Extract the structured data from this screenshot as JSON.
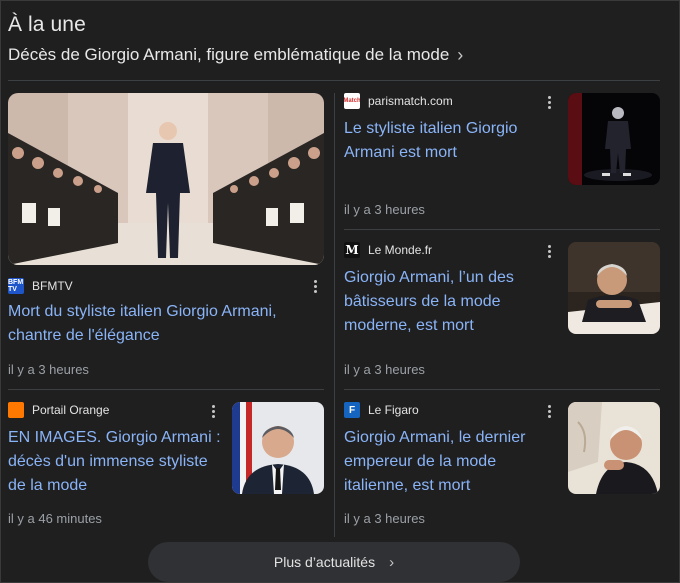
{
  "section_title": "À la une",
  "topic": {
    "title": "Décès de Giorgio Armani, figure emblématique de la mode",
    "chevron": "›"
  },
  "articles": [
    {
      "source": "BFMTV",
      "favicon_text": "BFM TV",
      "favicon_color": "#1e56c9",
      "headline": "Mort du styliste italien Giorgio Armani, chantre de l'élégance",
      "time": "il y a 3 heures"
    },
    {
      "source": "parismatch.com",
      "favicon_text": "Match",
      "favicon_color": "#d32f2f",
      "headline": "Le styliste italien Giorgio Armani est mort",
      "time": "il y a 3 heures"
    },
    {
      "source": "Le Monde.fr",
      "favicon_text": "M",
      "favicon_color": "#111111",
      "headline": "Giorgio Armani, l’un des bâtisseurs de la mode moderne, est mort",
      "time": "il y a 3 heures"
    },
    {
      "source": "Portail Orange",
      "favicon_text": "",
      "favicon_color": "#ff7900",
      "headline": "EN IMAGES. Giorgio Armani : décès d'un immense styliste de la mode",
      "time": "il y a 46 minutes"
    },
    {
      "source": "Le Figaro",
      "favicon_text": "F",
      "favicon_color": "#1565c0",
      "headline": "Giorgio Armani, le dernier empereur de la mode italienne, est mort",
      "time": "il y a 3 heures"
    }
  ],
  "more_news": {
    "label": "Plus d’actualités",
    "chevron": "›"
  },
  "colors": {
    "background": "#1f1f1f",
    "link": "#8ab4f8",
    "muted": "#9aa0a6",
    "divider": "#3c4043"
  }
}
